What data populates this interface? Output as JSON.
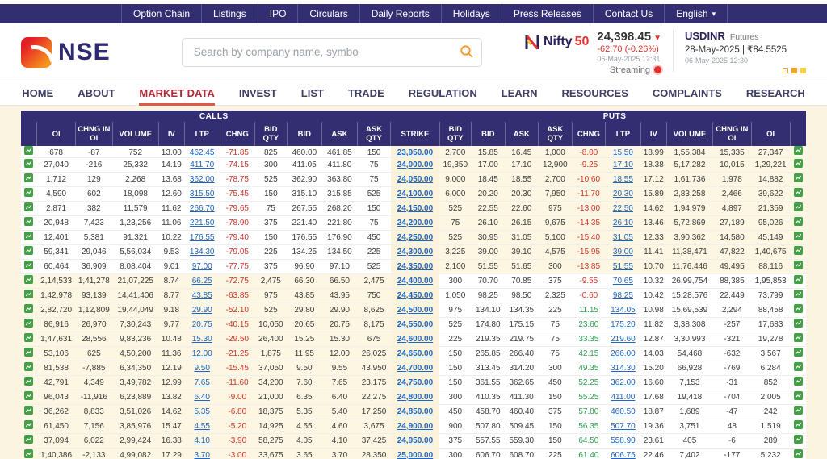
{
  "topbar": {
    "items": [
      {
        "label": "Option Chain"
      },
      {
        "label": "Listings"
      },
      {
        "label": "IPO"
      },
      {
        "label": "Circulars"
      },
      {
        "label": "Daily Reports"
      },
      {
        "label": "Holidays"
      },
      {
        "label": "Press Releases"
      },
      {
        "label": "Contact Us"
      },
      {
        "label": "English",
        "caret": true
      }
    ]
  },
  "icons": {
    "caret_down": "▼",
    "dropdown_caret": "▾"
  },
  "header": {
    "logo_text": "NSE",
    "search_placeholder": "Search by company name, symbo",
    "index": {
      "name_prefix": "Nifty",
      "name_suffix": "50",
      "value": "24,398.45",
      "change": "-62.70 (-0.26%)",
      "timestamp": "06-May-2025 12:31",
      "streaming_label": "Streaming"
    },
    "usdinr": {
      "symbol": "USDINR",
      "type": "Futures",
      "expiry_price": "28-May-2025 | ₹84.5525",
      "timestamp": "06-May-2025 12:30"
    }
  },
  "nav": {
    "items": [
      "HOME",
      "ABOUT",
      "MARKET DATA",
      "INVEST",
      "LIST",
      "TRADE",
      "REGULATION",
      "LEARN",
      "RESOURCES",
      "COMPLAINTS",
      "RESEARCH"
    ],
    "active": "MARKET DATA"
  },
  "colors": {
    "navy": "#332e72",
    "accent_red": "#e03131",
    "link_blue": "#2065c0",
    "positive_green": "#2e9e4f",
    "negative_red": "#d0342c",
    "itm_cream": "#fcf6e2",
    "icon_green": "#43a047"
  },
  "option_chain": {
    "group_headers": {
      "calls": "CALLS",
      "puts": "PUTS"
    },
    "columns": [
      "OI",
      "CHNG IN OI",
      "VOLUME",
      "IV",
      "LTP",
      "CHNG",
      "BID QTY",
      "BID",
      "ASK",
      "ASK QTY",
      "STRIKE",
      "BID QTY",
      "BID",
      "ASK",
      "ASK QTY",
      "CHNG",
      "LTP",
      "IV",
      "VOLUME",
      "CHNG IN OI",
      "OI"
    ],
    "spot": 24398.45,
    "rows": [
      [
        "678",
        "-87",
        "752",
        "13.00",
        "462.45",
        "-71.85",
        "825",
        "460.00",
        "461.85",
        "150",
        "23,950.00",
        "2,700",
        "15.85",
        "16.45",
        "1,000",
        "-8.00",
        "15.50",
        "18.99",
        "1,55,384",
        "15,335",
        "27,347"
      ],
      [
        "27,040",
        "-216",
        "25,332",
        "14.19",
        "411.70",
        "-74.15",
        "300",
        "411.05",
        "411.80",
        "75",
        "24,000.00",
        "19,350",
        "17.00",
        "17.10",
        "12,900",
        "-9.25",
        "17.10",
        "18.38",
        "5,17,282",
        "10,015",
        "1,29,221"
      ],
      [
        "1,712",
        "129",
        "2,268",
        "13.68",
        "362.00",
        "-78.75",
        "525",
        "362.90",
        "363.80",
        "75",
        "24,050.00",
        "9,000",
        "18.45",
        "18.55",
        "2,700",
        "-10.60",
        "18.55",
        "17.12",
        "1,61,736",
        "1,978",
        "14,882"
      ],
      [
        "4,590",
        "602",
        "18,098",
        "12.60",
        "315.50",
        "-75.45",
        "150",
        "315.10",
        "315.85",
        "525",
        "24,100.00",
        "6,000",
        "20.20",
        "20.30",
        "7,950",
        "-11.70",
        "20.30",
        "15.89",
        "2,83,258",
        "2,466",
        "39,622"
      ],
      [
        "2,871",
        "382",
        "11,579",
        "11.62",
        "266.70",
        "-79.65",
        "75",
        "267.55",
        "268.20",
        "150",
        "24,150.00",
        "525",
        "22.55",
        "22.60",
        "975",
        "-13.00",
        "22.50",
        "14.62",
        "1,94,979",
        "4,897",
        "21,359"
      ],
      [
        "20,948",
        "7,423",
        "1,23,256",
        "11.06",
        "221.50",
        "-78.90",
        "375",
        "221.40",
        "221.80",
        "75",
        "24,200.00",
        "75",
        "26.10",
        "26.15",
        "9,675",
        "-14.35",
        "26.10",
        "13.46",
        "5,72,869",
        "27,189",
        "95,026"
      ],
      [
        "12,401",
        "5,381",
        "91,321",
        "10.22",
        "176.55",
        "-79.40",
        "150",
        "176.55",
        "176.90",
        "450",
        "24,250.00",
        "525",
        "30.95",
        "31.05",
        "5,100",
        "-15.40",
        "31.05",
        "12.33",
        "3,90,362",
        "14,580",
        "45,149"
      ],
      [
        "59,341",
        "29,046",
        "5,56,034",
        "9.53",
        "134.30",
        "-79.05",
        "225",
        "134.25",
        "134.50",
        "225",
        "24,300.00",
        "3,225",
        "39.00",
        "39.10",
        "4,575",
        "-15.95",
        "39.00",
        "11.41",
        "11,38,471",
        "47,822",
        "1,40,675"
      ],
      [
        "60,464",
        "36,909",
        "8,08,404",
        "9.01",
        "97.00",
        "-77.75",
        "375",
        "96.90",
        "97.10",
        "525",
        "24,350.00",
        "2,100",
        "51.55",
        "51.65",
        "300",
        "-13.85",
        "51.55",
        "10.70",
        "11,76,446",
        "49,495",
        "88,116"
      ],
      [
        "2,14,533",
        "1,41,278",
        "21,07,225",
        "8.74",
        "66.25",
        "-72.75",
        "2,475",
        "66.30",
        "66.50",
        "2,475",
        "24,400.00",
        "300",
        "70.70",
        "70.85",
        "375",
        "-9.55",
        "70.65",
        "10.32",
        "26,99,754",
        "88,385",
        "1,95,853"
      ],
      [
        "1,42,978",
        "93,139",
        "14,41,406",
        "8.77",
        "43.85",
        "-63.85",
        "975",
        "43.85",
        "43.95",
        "750",
        "24,450.00",
        "1,050",
        "98.25",
        "98.50",
        "2,325",
        "-0.60",
        "98.25",
        "10.42",
        "15,28,576",
        "22,449",
        "73,799"
      ],
      [
        "2,82,720",
        "1,12,809",
        "19,44,049",
        "9.18",
        "29.90",
        "-52.10",
        "525",
        "29.80",
        "29.90",
        "8,625",
        "24,500.00",
        "975",
        "134.10",
        "134.35",
        "225",
        "11.15",
        "134.05",
        "10.98",
        "15,69,539",
        "2,294",
        "88,458"
      ],
      [
        "86,916",
        "26,970",
        "7,30,243",
        "9.77",
        "20.75",
        "-40.15",
        "10,050",
        "20.65",
        "20.75",
        "8,175",
        "24,550.00",
        "525",
        "174.80",
        "175.15",
        "75",
        "23.60",
        "175.20",
        "11.82",
        "3,38,308",
        "-257",
        "17,683"
      ],
      [
        "1,47,631",
        "28,556",
        "9,83,236",
        "10.48",
        "15.30",
        "-29.50",
        "26,400",
        "15.25",
        "15.30",
        "675",
        "24,600.00",
        "225",
        "219.35",
        "219.75",
        "75",
        "33.35",
        "219.60",
        "12.87",
        "3,30,993",
        "-321",
        "19,278"
      ],
      [
        "53,106",
        "625",
        "4,50,200",
        "11.36",
        "12.00",
        "-21.25",
        "1,875",
        "11.95",
        "12.00",
        "26,025",
        "24,650.00",
        "150",
        "265.85",
        "266.40",
        "75",
        "42.15",
        "266.00",
        "14.03",
        "54,468",
        "-632",
        "3,567"
      ],
      [
        "81,538",
        "-7,885",
        "6,34,350",
        "12.19",
        "9.50",
        "-15.45",
        "37,050",
        "9.50",
        "9.55",
        "43,950",
        "24,700.00",
        "150",
        "313.45",
        "314.20",
        "300",
        "49.35",
        "314.30",
        "15.20",
        "66,928",
        "-769",
        "6,284"
      ],
      [
        "42,791",
        "4,349",
        "3,49,782",
        "12.99",
        "7.65",
        "-11.60",
        "34,200",
        "7.60",
        "7.65",
        "23,175",
        "24,750.00",
        "150",
        "361.55",
        "362.65",
        "450",
        "52.25",
        "362.00",
        "16.60",
        "7,153",
        "-31",
        "852"
      ],
      [
        "96,043",
        "-11,916",
        "6,23,889",
        "13.82",
        "6.40",
        "-9.00",
        "21,000",
        "6.35",
        "6.40",
        "22,275",
        "24,800.00",
        "300",
        "410.35",
        "411.30",
        "150",
        "55.25",
        "411.00",
        "17.68",
        "19,418",
        "-704",
        "2,005"
      ],
      [
        "36,262",
        "8,833",
        "3,51,026",
        "14.62",
        "5.35",
        "-6.80",
        "18,375",
        "5.35",
        "5.40",
        "17,250",
        "24,850.00",
        "450",
        "458.70",
        "460.40",
        "375",
        "57.80",
        "460.50",
        "18.87",
        "1,689",
        "-47",
        "242"
      ],
      [
        "61,450",
        "7,156",
        "3,85,976",
        "15.47",
        "4.55",
        "-5.20",
        "14,925",
        "4.55",
        "4.60",
        "3,675",
        "24,900.00",
        "900",
        "507.80",
        "509.45",
        "150",
        "56.35",
        "507.70",
        "19.36",
        "3,751",
        "48",
        "1,519"
      ],
      [
        "37,094",
        "6,022",
        "2,99,424",
        "16.38",
        "4.10",
        "-3.90",
        "58,275",
        "4.05",
        "4.10",
        "37,425",
        "24,950.00",
        "375",
        "557.55",
        "559.30",
        "150",
        "64.50",
        "558.90",
        "23.61",
        "405",
        "-6",
        "289"
      ],
      [
        "1,40,386",
        "-2,133",
        "4,99,082",
        "17.29",
        "3.70",
        "-3.00",
        "33,675",
        "3.65",
        "3.70",
        "28,350",
        "25,000.00",
        "300",
        "606.70",
        "608.70",
        "225",
        "61.40",
        "606.75",
        "22.46",
        "7,402",
        "-177",
        "5,232"
      ]
    ]
  }
}
